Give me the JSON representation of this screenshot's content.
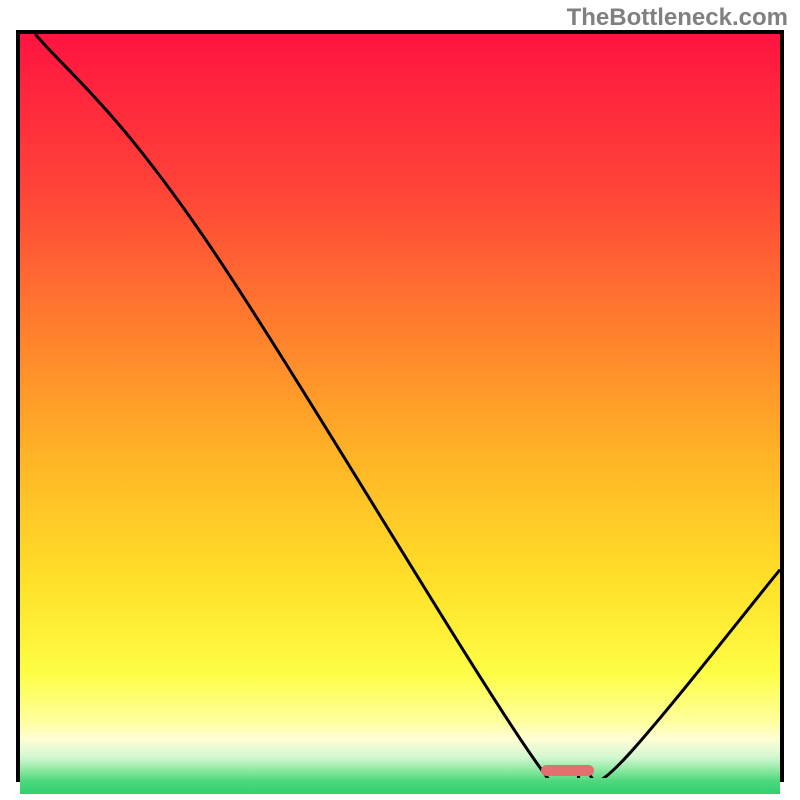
{
  "watermark": "TheBottleneck.com",
  "chart_data": {
    "type": "line",
    "title": "",
    "xlabel": "",
    "ylabel": "",
    "xlim": [
      0,
      100
    ],
    "ylim": [
      0,
      100
    ],
    "series": [
      {
        "name": "bottleneck-curve",
        "x": [
          2,
          24,
          68,
          74,
          79,
          100
        ],
        "y": [
          100,
          73,
          2,
          1,
          2,
          28
        ]
      }
    ],
    "marker": {
      "x": 72,
      "y": 1,
      "width": 7,
      "height": 1.5,
      "color": "#e36f6f"
    },
    "gradient_stops": [
      {
        "t": 0.0,
        "color": "#ff1440"
      },
      {
        "t": 0.2,
        "color": "#ff4238"
      },
      {
        "t": 0.38,
        "color": "#ff7c2e"
      },
      {
        "t": 0.55,
        "color": "#ffb226"
      },
      {
        "t": 0.72,
        "color": "#ffe028"
      },
      {
        "t": 0.84,
        "color": "#fdfd44"
      },
      {
        "t": 0.904,
        "color": "#feff9c"
      },
      {
        "t": 0.928,
        "color": "#fefed5"
      },
      {
        "t": 0.952,
        "color": "#d2f7d0"
      },
      {
        "t": 0.967,
        "color": "#93eaa5"
      },
      {
        "t": 0.983,
        "color": "#4fd87d"
      },
      {
        "t": 1.0,
        "color": "#2fd070"
      }
    ]
  }
}
